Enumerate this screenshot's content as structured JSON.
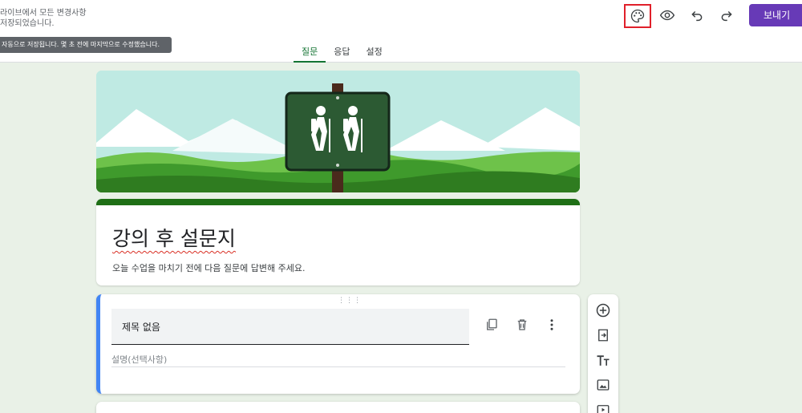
{
  "header": {
    "save_status_line1": "라이브에서 모든 변경사항",
    "save_status_line2": "저장되었습니다.",
    "tooltip": "자동으로 저장됩니다. 몇 초 전에 마지막으로 수정했습니다.",
    "send_label": "보내기",
    "icons": [
      "palette-icon",
      "eye-icon",
      "undo-icon",
      "redo-icon"
    ]
  },
  "tabs": [
    {
      "label": "질문",
      "active": true
    },
    {
      "label": "응답",
      "active": false
    },
    {
      "label": "설정",
      "active": false
    }
  ],
  "form": {
    "title": "강의 후 설문지",
    "description": "오늘 수업을 마치기 전에 다음 질문에 답변해 주세요."
  },
  "question": {
    "title": "제목 없음",
    "description_placeholder": "설명(선택사항)",
    "icons": [
      "copy-icon",
      "trash-icon",
      "more-vert-icon"
    ]
  },
  "floating_toolbar": {
    "icons": [
      "add-question-icon",
      "import-questions-icon",
      "add-title-icon",
      "add-image-icon",
      "add-video-icon"
    ]
  },
  "colors": {
    "accent": "#673ab7",
    "theme": "#1f6f16",
    "active_tab": "#137333",
    "question_focus": "#4285f4",
    "background": "#e9f1e7"
  }
}
